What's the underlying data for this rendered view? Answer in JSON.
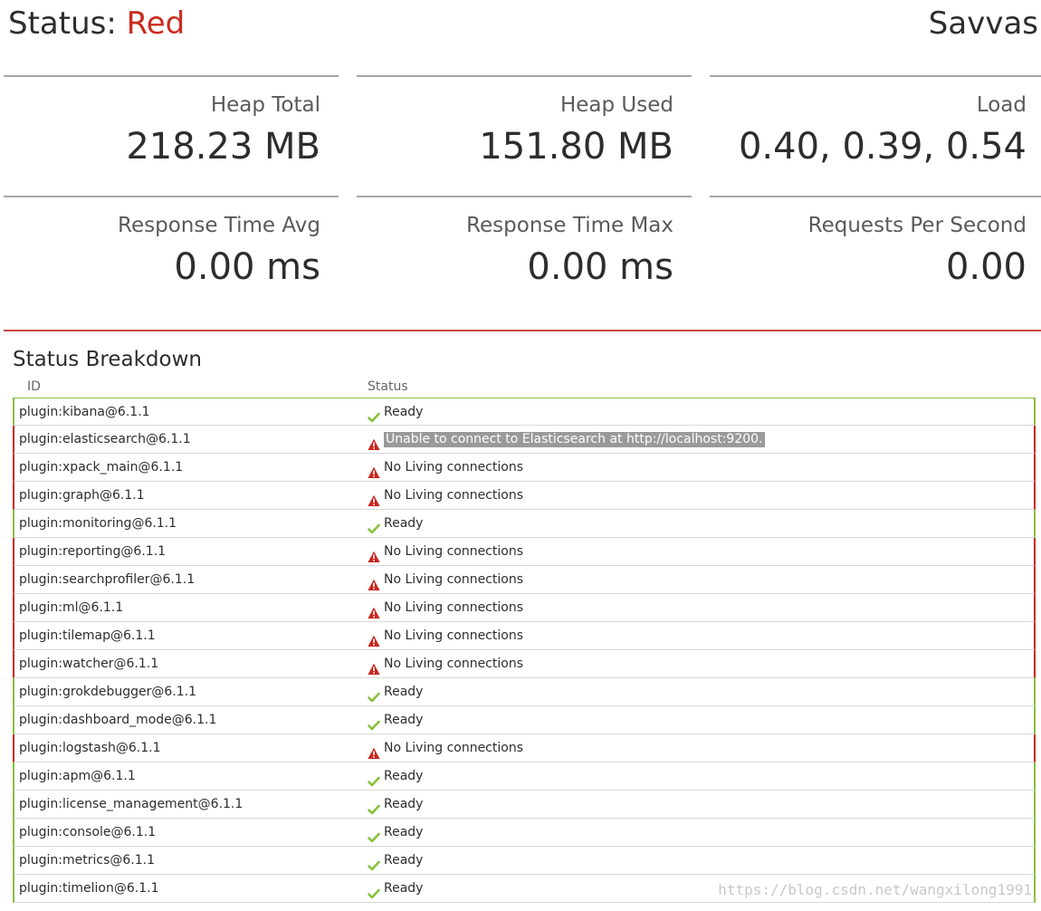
{
  "header": {
    "status_prefix": "Status: ",
    "status_value": "Red",
    "server_name": "Savvas"
  },
  "metrics": [
    {
      "label": "Heap Total",
      "value": "218.23 MB"
    },
    {
      "label": "Heap Used",
      "value": "151.80 MB"
    },
    {
      "label": "Load",
      "value": "0.40, 0.39, 0.54"
    },
    {
      "label": "Response Time Avg",
      "value": "0.00 ms"
    },
    {
      "label": "Response Time Max",
      "value": "0.00 ms"
    },
    {
      "label": "Requests Per Second",
      "value": "0.00"
    }
  ],
  "breakdown": {
    "title": "Status Breakdown",
    "columns": {
      "id": "ID",
      "status": "Status"
    },
    "rows": [
      {
        "id": "plugin:kibana@6.1.1",
        "state": "green",
        "message": "Ready"
      },
      {
        "id": "plugin:elasticsearch@6.1.1",
        "state": "red",
        "message": "Unable to connect to Elasticsearch at http://localhost:9200.",
        "highlight": true
      },
      {
        "id": "plugin:xpack_main@6.1.1",
        "state": "red",
        "message": "No Living connections"
      },
      {
        "id": "plugin:graph@6.1.1",
        "state": "red",
        "message": "No Living connections"
      },
      {
        "id": "plugin:monitoring@6.1.1",
        "state": "green",
        "message": "Ready"
      },
      {
        "id": "plugin:reporting@6.1.1",
        "state": "red",
        "message": "No Living connections"
      },
      {
        "id": "plugin:searchprofiler@6.1.1",
        "state": "red",
        "message": "No Living connections"
      },
      {
        "id": "plugin:ml@6.1.1",
        "state": "red",
        "message": "No Living connections"
      },
      {
        "id": "plugin:tilemap@6.1.1",
        "state": "red",
        "message": "No Living connections"
      },
      {
        "id": "plugin:watcher@6.1.1",
        "state": "red",
        "message": "No Living connections"
      },
      {
        "id": "plugin:grokdebugger@6.1.1",
        "state": "green",
        "message": "Ready"
      },
      {
        "id": "plugin:dashboard_mode@6.1.1",
        "state": "green",
        "message": "Ready"
      },
      {
        "id": "plugin:logstash@6.1.1",
        "state": "red",
        "message": "No Living connections"
      },
      {
        "id": "plugin:apm@6.1.1",
        "state": "green",
        "message": "Ready"
      },
      {
        "id": "plugin:license_management@6.1.1",
        "state": "green",
        "message": "Ready"
      },
      {
        "id": "plugin:console@6.1.1",
        "state": "green",
        "message": "Ready"
      },
      {
        "id": "plugin:metrics@6.1.1",
        "state": "green",
        "message": "Ready"
      },
      {
        "id": "plugin:timelion@6.1.1",
        "state": "green",
        "message": "Ready"
      }
    ]
  },
  "icons": {
    "green": "checkmark-icon",
    "red": "warning-triangle-icon"
  },
  "colors": {
    "red": "#c9261d",
    "green": "#86c13b",
    "status_red_text": "#cc2a1e"
  },
  "watermark": "https://blog.csdn.net/wangxilong1991"
}
